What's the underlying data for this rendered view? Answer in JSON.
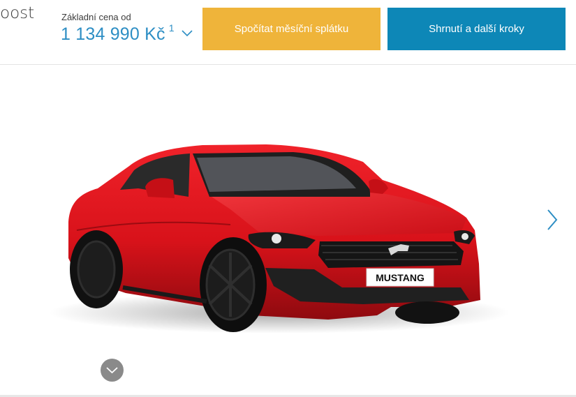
{
  "header": {
    "model_title": "oost",
    "price_label": "Základní cena od",
    "price_value": "1 134 990 Kč",
    "price_footnote": "1",
    "calc_button": "Spočítat měsíční splátku",
    "summary_button": "Shrnutí a další kroky"
  },
  "car": {
    "plate_text": "MUSTANG",
    "body_color": "#d8121a"
  },
  "colors": {
    "accent_blue": "#2d8ec4",
    "calc_yellow": "#efb43a",
    "summary_blue": "#0d87b7"
  },
  "icons": {
    "price_toggle": "chevron-down-icon",
    "next": "chevron-right-icon",
    "scroll": "chevron-down-icon"
  }
}
